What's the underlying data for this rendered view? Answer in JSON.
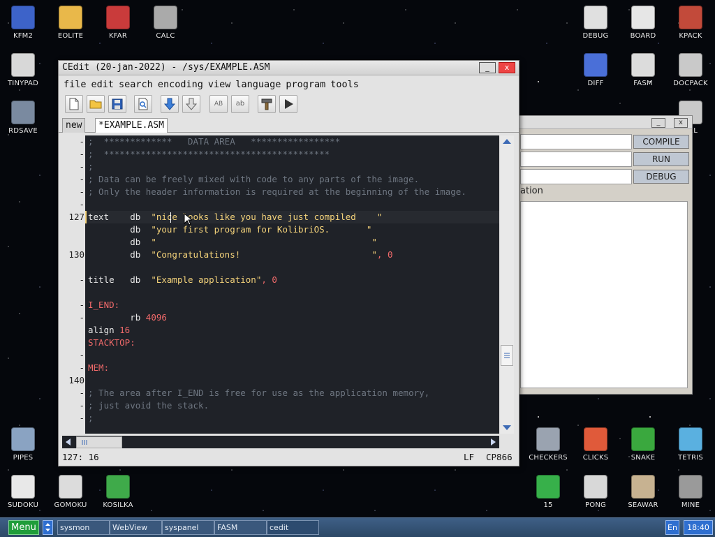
{
  "desktop": {
    "icons": [
      {
        "label": "KFM2",
        "icon": "floppy-icon"
      },
      {
        "label": "EOLITE",
        "icon": "folder-icon"
      },
      {
        "label": "KFAR",
        "icon": "kfar-icon"
      },
      {
        "label": "CALC",
        "icon": "calculator-icon"
      },
      {
        "label": "TINYPAD",
        "icon": "notepad-icon"
      },
      {
        "label": "RDSAVE",
        "icon": "rdsave-icon"
      },
      {
        "label": "DEBUG",
        "icon": "debug-icon"
      },
      {
        "label": "BOARD",
        "icon": "board-icon"
      },
      {
        "label": "KPACK",
        "icon": "kpack-icon"
      },
      {
        "label": "DIFF",
        "icon": "diff-icon"
      },
      {
        "label": "FASM",
        "icon": "fasm-icon"
      },
      {
        "label": "DOCPACK",
        "icon": "docpack-icon"
      },
      {
        "label": "NEL",
        "icon": "panel-icon"
      },
      {
        "label": "PIPES",
        "icon": "pipes-icon"
      },
      {
        "label": "SUDOKU",
        "icon": "sudoku-icon"
      },
      {
        "label": "GOMOKU",
        "icon": "gomoku-icon"
      },
      {
        "label": "KOSILKA",
        "icon": "lawnmower-icon"
      },
      {
        "label": "CHECKERS",
        "icon": "checkers-icon"
      },
      {
        "label": "CLICKS",
        "icon": "clicks-icon"
      },
      {
        "label": "SNAKE",
        "icon": "snake-icon"
      },
      {
        "label": "TETRIS",
        "icon": "tetris-icon"
      },
      {
        "label": "15",
        "icon": "fifteen-icon"
      },
      {
        "label": "PONG",
        "icon": "pong-icon"
      },
      {
        "label": "SEAWAR",
        "icon": "seawar-icon"
      },
      {
        "label": "MINE",
        "icon": "mine-icon"
      }
    ]
  },
  "fasm_window": {
    "buttons": {
      "compile": "COMPILE",
      "run": "RUN",
      "debug": "DEBUG"
    },
    "label": "ation",
    "min_label": "_",
    "close_label": "x"
  },
  "editor": {
    "title": "CEdit (20-jan-2022) - /sys/EXAMPLE.ASM",
    "min_label": "_",
    "close_label": "x",
    "menu": [
      "file",
      "edit",
      "search",
      "encoding",
      "view",
      "language",
      "program",
      "tools"
    ],
    "toolbar": {
      "new": "new-file-icon",
      "open": "open-folder-icon",
      "save": "save-icon",
      "find": "find-icon",
      "down1": "arrow-down-icon",
      "down2": "arrow-down-outline-icon",
      "upper": "AB",
      "lower": "ab",
      "build": "hammer-icon",
      "run": "play-icon"
    },
    "tabs": [
      "new",
      "*EXAMPLE.ASM"
    ],
    "gutter": [
      "-",
      "-",
      "-",
      "-",
      "-",
      "-",
      "127",
      "",
      "",
      "130",
      "",
      "-",
      "",
      "-",
      "-",
      "",
      "",
      "-",
      "-",
      "140",
      "-",
      "-",
      "-"
    ],
    "lines": [
      [
        {
          "c": "cmt",
          "t": ";  *************   DATA AREA   *****************"
        }
      ],
      [
        {
          "c": "cmt",
          "t": ";  *******************************************"
        }
      ],
      [
        {
          "c": "cmt",
          "t": ";"
        }
      ],
      [
        {
          "c": "cmt",
          "t": "; Data can be freely mixed with code to any parts of the image."
        }
      ],
      [
        {
          "c": "cmt",
          "t": "; Only the header information is required at the beginning of the image."
        }
      ],
      [
        {
          "c": "txt",
          "t": ""
        }
      ],
      [
        {
          "c": "txt",
          "t": "text    db  "
        },
        {
          "c": "str",
          "t": "\"nice looks like you have just compiled    \""
        }
      ],
      [
        {
          "c": "txt",
          "t": "        db  "
        },
        {
          "c": "str",
          "t": "\"your first program for KolibriOS.       \""
        }
      ],
      [
        {
          "c": "txt",
          "t": "        db  "
        },
        {
          "c": "str",
          "t": "\"                                         \""
        }
      ],
      [
        {
          "c": "txt",
          "t": "        db  "
        },
        {
          "c": "str",
          "t": "\"Congratulations!                         \""
        },
        {
          "c": "num",
          "t": ", 0"
        }
      ],
      [
        {
          "c": "txt",
          "t": ""
        }
      ],
      [
        {
          "c": "txt",
          "t": "title   db  "
        },
        {
          "c": "str",
          "t": "\"Example application\""
        },
        {
          "c": "num",
          "t": ", 0"
        }
      ],
      [
        {
          "c": "txt",
          "t": ""
        }
      ],
      [
        {
          "c": "lab",
          "t": "I_END:"
        }
      ],
      [
        {
          "c": "txt",
          "t": "        rb "
        },
        {
          "c": "num",
          "t": "4096"
        }
      ],
      [
        {
          "c": "txt",
          "t": "align "
        },
        {
          "c": "num",
          "t": "16"
        }
      ],
      [
        {
          "c": "lab",
          "t": "STACKTOP:"
        }
      ],
      [
        {
          "c": "txt",
          "t": ""
        }
      ],
      [
        {
          "c": "lab",
          "t": "MEM:"
        }
      ],
      [
        {
          "c": "txt",
          "t": ""
        }
      ],
      [
        {
          "c": "cmt",
          "t": "; The area after I_END is free for use as the application memory,"
        }
      ],
      [
        {
          "c": "cmt",
          "t": "; just avoid the stack."
        }
      ],
      [
        {
          "c": "cmt",
          "t": ";"
        }
      ]
    ],
    "status": {
      "position": "127: 16",
      "line_ending": "LF",
      "encoding": "CP866"
    }
  },
  "taskbar": {
    "menu_label": "Menu",
    "tasks": [
      "sysmon",
      "WebView",
      "syspanel",
      "FASM",
      "cedit"
    ],
    "lang": "En",
    "clock": "18:40"
  }
}
